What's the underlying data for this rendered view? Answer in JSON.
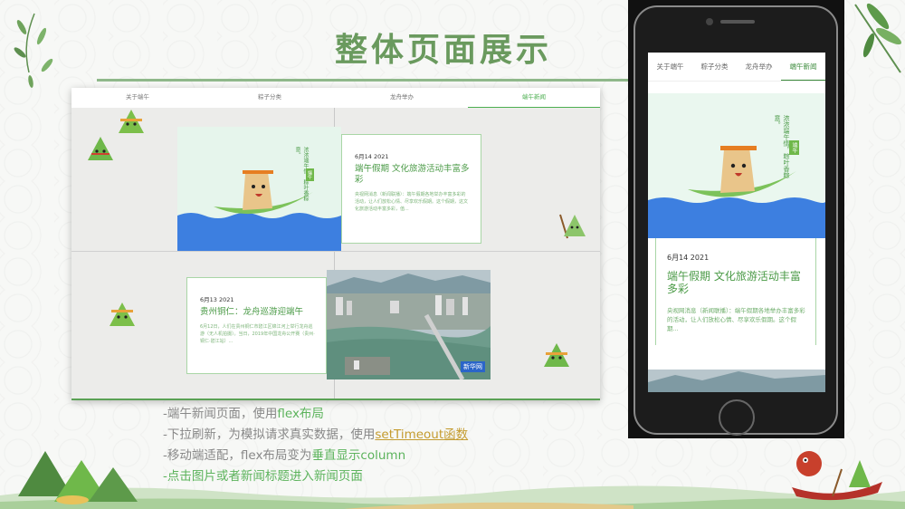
{
  "slide": {
    "title": "整体页面展示"
  },
  "desktop": {
    "tabs": [
      "关于端午",
      "粽子分类",
      "龙舟举办",
      "端午新闻"
    ],
    "active_tab_index": 3,
    "news1": {
      "date": "6月14 2021",
      "headline": "端午假期 文化旅游活动丰富多彩",
      "summary": "央视网消息（新闻联播）：端午假期各地举办丰富多彩的活动，让人们放松心情、尽享欢乐假期。这个假期，这文化旅游活动丰富多彩，值..."
    },
    "news2": {
      "date": "6月13 2021",
      "headline": "贵州铜仁：龙舟巡游迎端午",
      "summary": "6月12日，人们在贵州铜仁市碧江区锦江河上举行龙舟巡游（无人机拍摄）。当日，2019年中国龙舟公开赛（贵州·铜仁·碧江站）..."
    },
    "banner_text": "浓浓端午情，粽叶香粽意。",
    "banner_seal": "端午",
    "photo_watermark": "新华网"
  },
  "phone": {
    "tabs": [
      "关于端午",
      "粽子分类",
      "龙舟举办",
      "端午新闻"
    ],
    "active_tab_index": 3,
    "news": {
      "date": "6月14 2021",
      "headline": "端午假期 文化旅游活动丰富多彩",
      "summary": "央视网消息（新闻联播）：端午假期各地举办丰富多彩的活动，让人们放松心情、尽享欢乐假期。这个假期..."
    },
    "banner_text": "浓浓端午情，粽叶香粽意。",
    "banner_seal": "端午"
  },
  "bullets": {
    "b1_prefix": "-端午新闻页面，使用",
    "b1_highlight": "flex布局",
    "b2_prefix": "-下拉刷新，为模拟请求真实数据，使用",
    "b2_highlight": "setTimeout函数",
    "b3_prefix": "-移动端适配，flex布局变为",
    "b3_highlight": "垂直显示column",
    "b4": "-点击图片或者新闻标题进入新闻页面"
  },
  "colors": {
    "accent_green": "#5cb35c",
    "title_green": "#6a9a5e",
    "highlight_gold": "#c49b2e",
    "water_blue": "#3d7fe0"
  }
}
